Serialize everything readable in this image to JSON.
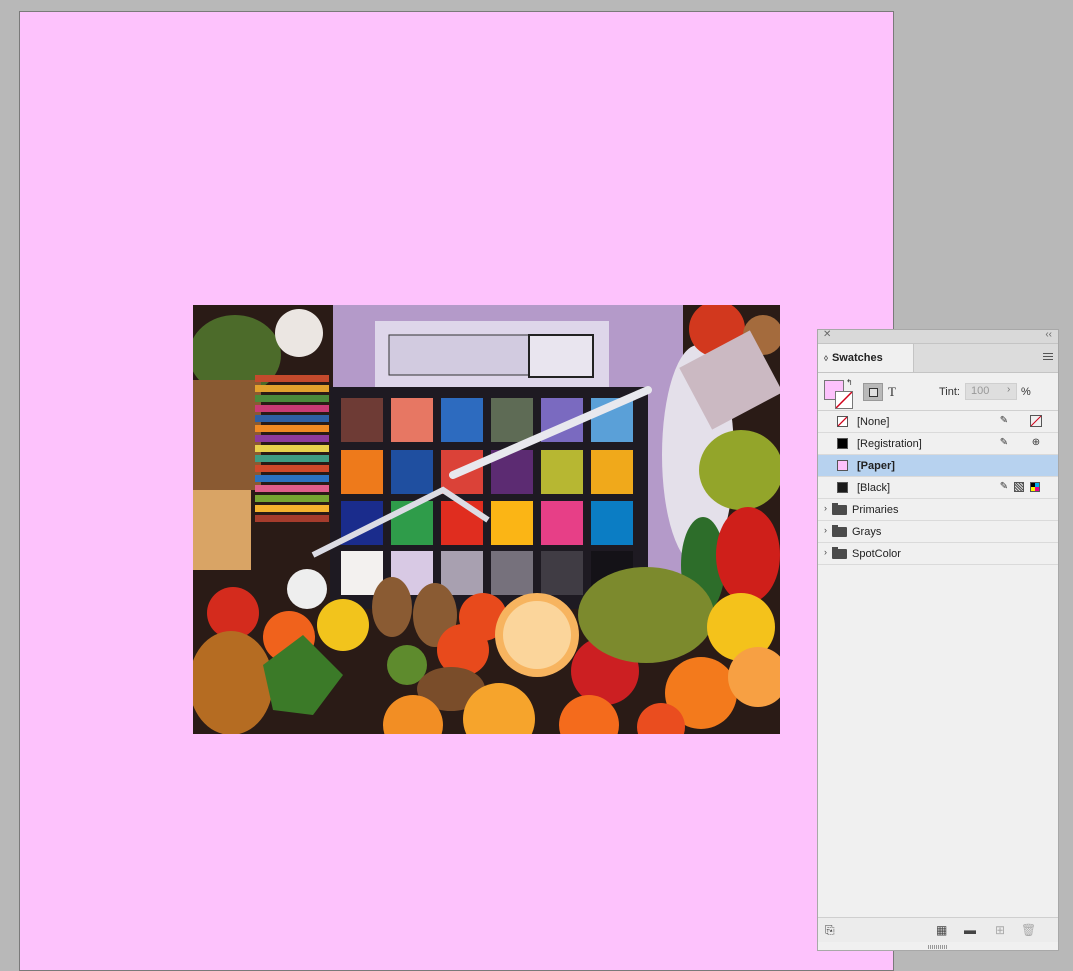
{
  "document": {
    "page_color": "#fdc2fc",
    "pasteboard_color": "#b8b8b8",
    "placed_image_description": "color chart still life"
  },
  "swatches_panel": {
    "tab_title": "Swatches",
    "tint_label": "Tint:",
    "tint_value": "100",
    "tint_unit": "%",
    "text_button_label": "T",
    "swatches": [
      {
        "name": "[None]",
        "color": "none",
        "icons": [
          "pencil-cross-icon",
          "none-mode-icon"
        ]
      },
      {
        "name": "[Registration]",
        "color": "#000000",
        "icons": [
          "pencil-cross-icon",
          "registration-mode-icon"
        ]
      },
      {
        "name": "[Paper]",
        "color": "#fdc2fc",
        "selected": true,
        "icons": []
      },
      {
        "name": "[Black]",
        "color": "#1a1a1a",
        "icons": [
          "pencil-cross-icon",
          "process-icon",
          "cmyk-icon"
        ]
      }
    ],
    "groups": [
      {
        "name": "Primaries"
      },
      {
        "name": "Grays"
      },
      {
        "name": "SpotColor"
      }
    ]
  },
  "colors": {
    "selection": "#b7d2ef",
    "panel_bg": "#f0f0f0"
  }
}
